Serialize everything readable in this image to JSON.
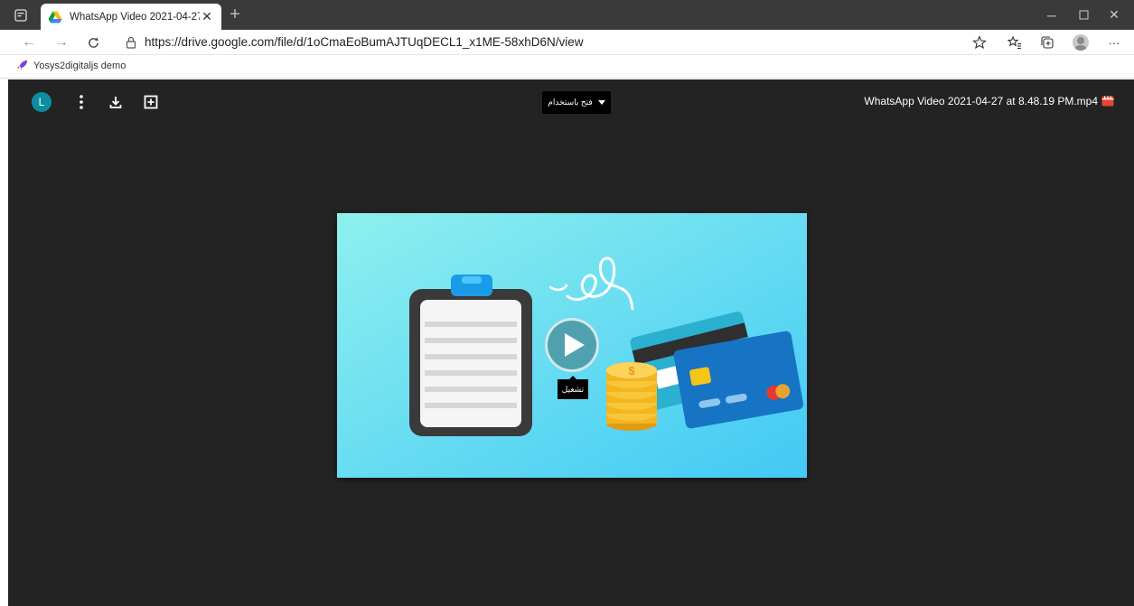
{
  "browser": {
    "tab_title": "WhatsApp Video 2021-04-27 at 8.48.19 PM.mp4",
    "new_tab_symbol": "+",
    "url": "https://drive.google.com/file/d/1oCmaEoBumAJTUqDECL1_x1ME-58xhD6N/view",
    "bookmark_label": "Yosys2digitaljs demo"
  },
  "viewer": {
    "user_initial": "L",
    "open_with_label": "فتح باستخدام",
    "file_name": "WhatsApp Video 2021-04-27 at 8.48.19 PM.mp4",
    "play_tooltip": "تشغيل"
  },
  "colors": {
    "viewer_bg": "#232323",
    "avatar": "#0b8fa0",
    "file_icon": "#ea4335"
  }
}
